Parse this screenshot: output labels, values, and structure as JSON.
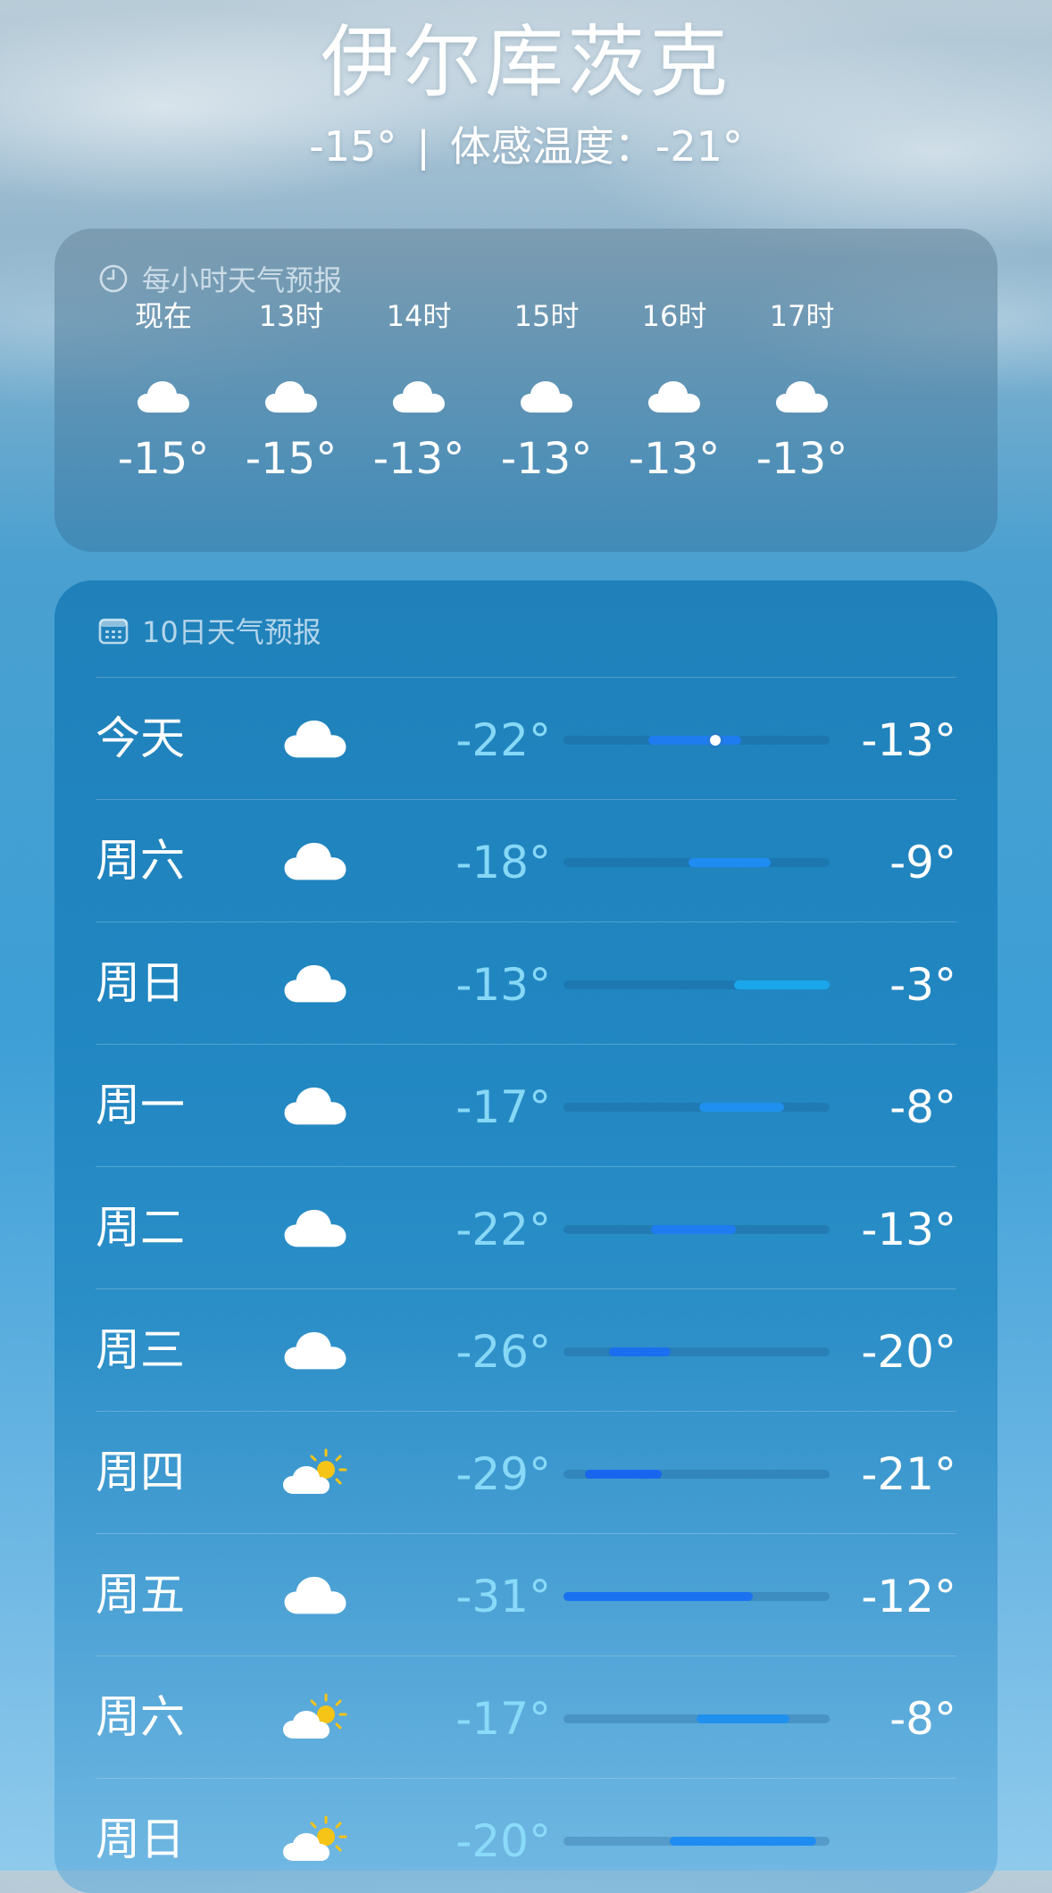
{
  "location": {
    "city": "伊尔库茨克",
    "current_temp": "-15°",
    "feels_like_text": "体感温度：-21°"
  },
  "hourly": {
    "title": "每小时天气预报",
    "icon": "clock-icon",
    "hours": [
      {
        "label": "现在",
        "icon": "cloud-icon",
        "temp": "-15°"
      },
      {
        "label": "13时",
        "icon": "cloud-icon",
        "temp": "-15°"
      },
      {
        "label": "14时",
        "icon": "cloud-icon",
        "temp": "-13°"
      },
      {
        "label": "15时",
        "icon": "cloud-icon",
        "temp": "-13°"
      },
      {
        "label": "16时",
        "icon": "cloud-icon",
        "temp": "-13°"
      },
      {
        "label": "17时",
        "icon": "cloud-icon",
        "temp": "-13°"
      }
    ]
  },
  "daily": {
    "title": "10日天气预报",
    "icon": "calendar-icon",
    "days": [
      {
        "day": "今天",
        "icon": "cloud-icon",
        "low": "-22°",
        "high": "-13°",
        "bar_start": 0.32,
        "bar_end": 0.67,
        "current_marker": 0.57,
        "bar_color": "#1e7cf0"
      },
      {
        "day": "周六",
        "icon": "cloud-icon",
        "low": "-18°",
        "high": "-9°",
        "bar_start": 0.47,
        "bar_end": 0.78,
        "bar_color": "#1f8cf2"
      },
      {
        "day": "周日",
        "icon": "cloud-icon",
        "low": "-13°",
        "high": "-3°",
        "bar_start": 0.64,
        "bar_end": 1.0,
        "bar_color": "#1aa6ea"
      },
      {
        "day": "周一",
        "icon": "cloud-icon",
        "low": "-17°",
        "high": "-8°",
        "bar_start": 0.51,
        "bar_end": 0.83,
        "bar_color": "#1f90ee"
      },
      {
        "day": "周二",
        "icon": "cloud-icon",
        "low": "-22°",
        "high": "-13°",
        "bar_start": 0.33,
        "bar_end": 0.65,
        "bar_color": "#1e7cf0"
      },
      {
        "day": "周三",
        "icon": "cloud-icon",
        "low": "-26°",
        "high": "-20°",
        "bar_start": 0.17,
        "bar_end": 0.4,
        "bar_color": "#1a6ef0"
      },
      {
        "day": "周四",
        "icon": "partly-sunny-icon",
        "low": "-29°",
        "high": "-21°",
        "bar_start": 0.08,
        "bar_end": 0.37,
        "bar_color": "#1966ee"
      },
      {
        "day": "周五",
        "icon": "cloud-icon",
        "low": "-31°",
        "high": "-12°",
        "bar_start": 0.0,
        "bar_end": 0.71,
        "bar_color": "#1a72f0"
      },
      {
        "day": "周六",
        "icon": "partly-sunny-icon",
        "low": "-17°",
        "high": "-8°",
        "bar_start": 0.5,
        "bar_end": 0.85,
        "bar_color": "#1f90ee"
      },
      {
        "day": "周日",
        "icon": "partly-sunny-icon",
        "low": "-20°",
        "high": "",
        "bar_start": 0.4,
        "bar_end": 0.95,
        "bar_color": "#1f8cf2"
      }
    ]
  }
}
